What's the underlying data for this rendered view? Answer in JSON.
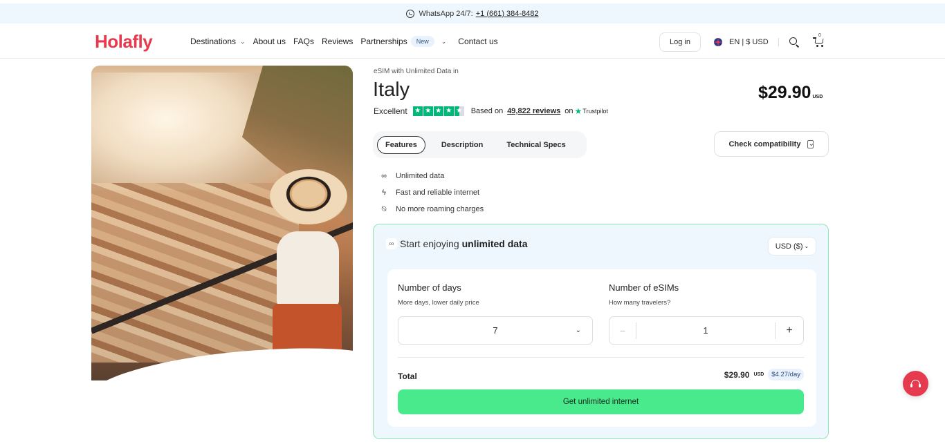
{
  "topbar": {
    "whatsapp_label": "WhatsApp 24/7:",
    "phone": "+1 (661) 384-8482",
    "icon": "whatsapp-icon"
  },
  "nav": {
    "logo": "Holafly",
    "items": [
      {
        "label": "Destinations",
        "has_dropdown": true
      },
      {
        "label": "About us"
      },
      {
        "label": "FAQs"
      },
      {
        "label": "Reviews"
      },
      {
        "label": "Partnerships",
        "badge": "New",
        "has_dropdown": true
      },
      {
        "label": "Contact us"
      }
    ],
    "login": "Log in",
    "language": "EN | $ USD",
    "cart_count": "0",
    "icons": [
      "uk-flag-icon",
      "search-icon",
      "cart-icon"
    ]
  },
  "product": {
    "subtitle": "eSIM with Unlimited Data in",
    "title": "Italy",
    "price": "$29.90",
    "price_currency": "USD",
    "rating": {
      "label": "Excellent",
      "stars": 4.5,
      "based_on": "Based on",
      "reviews": "49,822 reviews",
      "on": "on",
      "provider": "Trustpilot"
    },
    "tabs": [
      {
        "label": "Features",
        "active": true
      },
      {
        "label": "Description",
        "active": false
      },
      {
        "label": "Technical Specs",
        "active": false
      }
    ],
    "check_compatibility": "Check compatibility",
    "features": [
      {
        "icon": "infinity-icon",
        "glyph": "∞",
        "label": "Unlimited data"
      },
      {
        "icon": "lightning-icon",
        "glyph": "ϟ",
        "label": "Fast and reliable internet"
      },
      {
        "icon": "no-roaming-icon",
        "glyph": "⍉",
        "label": "No more roaming charges"
      }
    ]
  },
  "purchase": {
    "heading_prefix": "Start enjoying",
    "heading_bold": "unlimited data",
    "currency_select": "USD ($)",
    "days": {
      "title": "Number of days",
      "subtitle": "More days, lower daily price",
      "value": "7"
    },
    "esims": {
      "title": "Number of eSIMs",
      "subtitle": "How many travelers?",
      "value": "1",
      "minus": "−",
      "plus": "+"
    },
    "total_label": "Total",
    "total_price": "$29.90",
    "total_currency": "USD",
    "per_day": "$4.27/day",
    "cta": "Get unlimited internet"
  },
  "colors": {
    "brand": "#e63b4e",
    "cta": "#48ea8c",
    "card_border": "#8fe3b2",
    "card_bg": "#eef7fd",
    "trustpilot": "#00b67a"
  }
}
